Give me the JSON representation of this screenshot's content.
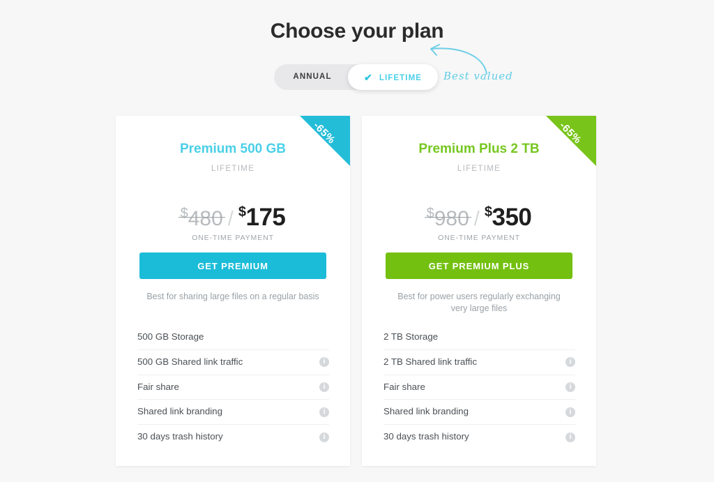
{
  "page": {
    "title": "Choose your plan",
    "background_color": "#f7f7f8"
  },
  "billing_toggle": {
    "annual_label": "ANNUAL",
    "lifetime_label": "LIFETIME",
    "selected": "LIFETIME",
    "check_glyph": "✔",
    "active_color": "#4ad0e8",
    "track_color": "#e8e8ea"
  },
  "annotation": {
    "text": "Best valued",
    "color": "#5fcde4",
    "icon": "curved-arrow-icon"
  },
  "plans": [
    {
      "id": "premium-500gb",
      "name": "Premium 500 GB",
      "name_color": "#4ad0e8",
      "period": "LIFETIME",
      "ribbon_text": "-65%",
      "ribbon_color": "#24bdd7",
      "currency": "$",
      "old_price": "480",
      "separator": "/",
      "new_price": "175",
      "payment_note": "ONE-TIME PAYMENT",
      "cta_label": "GET PREMIUM",
      "cta_color": "#1bbcd8",
      "blurb": "Best for sharing large files on a regular basis",
      "features": [
        {
          "label": "500 GB Storage",
          "has_info": false
        },
        {
          "label": "500 GB Shared link traffic",
          "has_info": true
        },
        {
          "label": "Fair share",
          "has_info": true
        },
        {
          "label": "Shared link branding",
          "has_info": true
        },
        {
          "label": "30 days trash history",
          "has_info": true
        }
      ]
    },
    {
      "id": "premium-plus-2tb",
      "name": "Premium Plus 2 TB",
      "name_color": "#76c720",
      "period": "LIFETIME",
      "ribbon_text": "-65%",
      "ribbon_color": "#78c41a",
      "currency": "$",
      "old_price": "980",
      "separator": "/",
      "new_price": "350",
      "payment_note": "ONE-TIME PAYMENT",
      "cta_label": "GET PREMIUM PLUS",
      "cta_color": "#73c010",
      "blurb": "Best for power users regularly exchanging very large files",
      "features": [
        {
          "label": "2 TB Storage",
          "has_info": false
        },
        {
          "label": "2 TB Shared link traffic",
          "has_info": true
        },
        {
          "label": "Fair share",
          "has_info": true
        },
        {
          "label": "Shared link branding",
          "has_info": true
        },
        {
          "label": "30 days trash history",
          "has_info": true
        }
      ]
    }
  ],
  "info_icon_glyph": "i"
}
